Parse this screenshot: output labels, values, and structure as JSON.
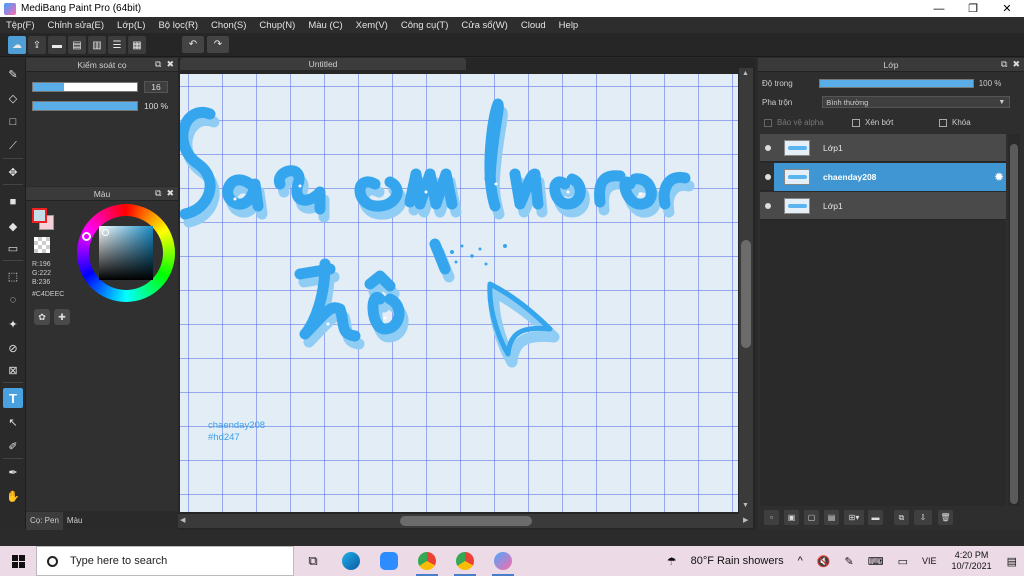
{
  "window": {
    "title": "MediBang Paint Pro (64bit)",
    "controls": [
      "—",
      "❐",
      "✕"
    ]
  },
  "menu": [
    "Tệp(F)",
    "Chỉnh sửa(E)",
    "Lớp(L)",
    "Bộ lọc(R)",
    "Chọn(S)",
    "Chụp(N)",
    "Màu (C)",
    "Xem(V)",
    "Công cụ(T)",
    "Cửa sổ(W)",
    "Cloud",
    "Help"
  ],
  "brush_panel": {
    "title": "Kiểm soát cọ",
    "size_value": "16",
    "size_fraction": 0.3,
    "opacity_value": "100 %",
    "opacity_fraction": 1.0
  },
  "color_panel": {
    "title": "Màu",
    "r": "R:196",
    "g": "G:222",
    "b": "B:236",
    "hex": "#C4DEEC",
    "main_color": "#C4DEEC"
  },
  "bottom_tabs": [
    "Cọ: Pen",
    "Màu"
  ],
  "document": {
    "tab_title": "Untitled",
    "hashtag_line1": "chaenday208",
    "hashtag_line2": "#hd247"
  },
  "layer_panel": {
    "title": "Lớp",
    "opacity_label": "Độ trong",
    "opacity_value": "100 %",
    "blend_label": "Pha trộn",
    "blend_value": "Bình thường",
    "protect_alpha": "Bảo vệ alpha",
    "clipping": "Xén bớt",
    "lock": "Khóa",
    "layers": [
      {
        "name": "Lớp1",
        "selected": false
      },
      {
        "name": "chaenday208",
        "selected": true
      },
      {
        "name": "Lớp1",
        "selected": false
      }
    ]
  },
  "taskbar": {
    "search_placeholder": "Type here to search",
    "weather": "80°F  Rain showers",
    "lang": "VIE",
    "time": "4:20 PM",
    "date": "10/7/2021"
  },
  "colors": {
    "accent": "#4aa1e0",
    "lettering": "#3aa8ee",
    "lettering_shadow": "#8fcdf5"
  }
}
